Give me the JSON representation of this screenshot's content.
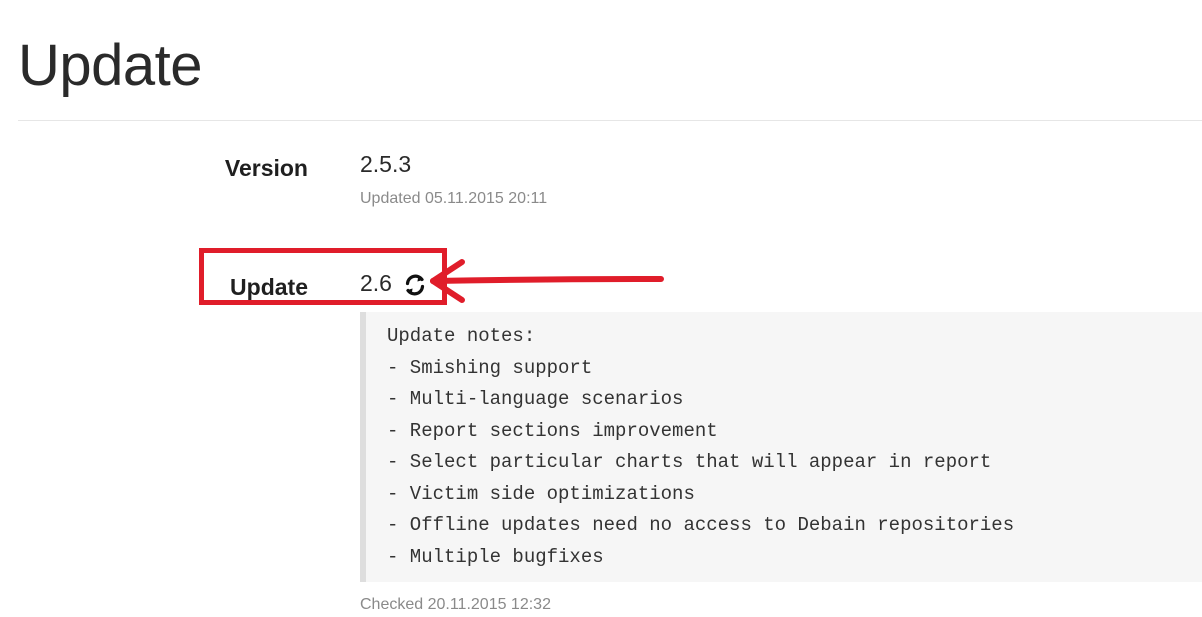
{
  "page": {
    "title": "Update"
  },
  "version": {
    "label": "Version",
    "value": "2.5.3",
    "updated": "Updated 05.11.2015 20:11"
  },
  "update": {
    "label": "Update",
    "value": "2.6",
    "refresh_icon": "refresh-icon",
    "notes": [
      "Update notes:",
      "- Smishing support",
      "- Multi-language scenarios",
      "- Report sections improvement",
      "- Select particular charts that will appear in report",
      "- Victim side optimizations",
      "- Offline updates need no access to Debain repositories",
      "- Multiple bugfixes"
    ],
    "checked": "Checked 20.11.2015 12:32"
  },
  "annotation": {
    "color": "#e01d2a"
  }
}
